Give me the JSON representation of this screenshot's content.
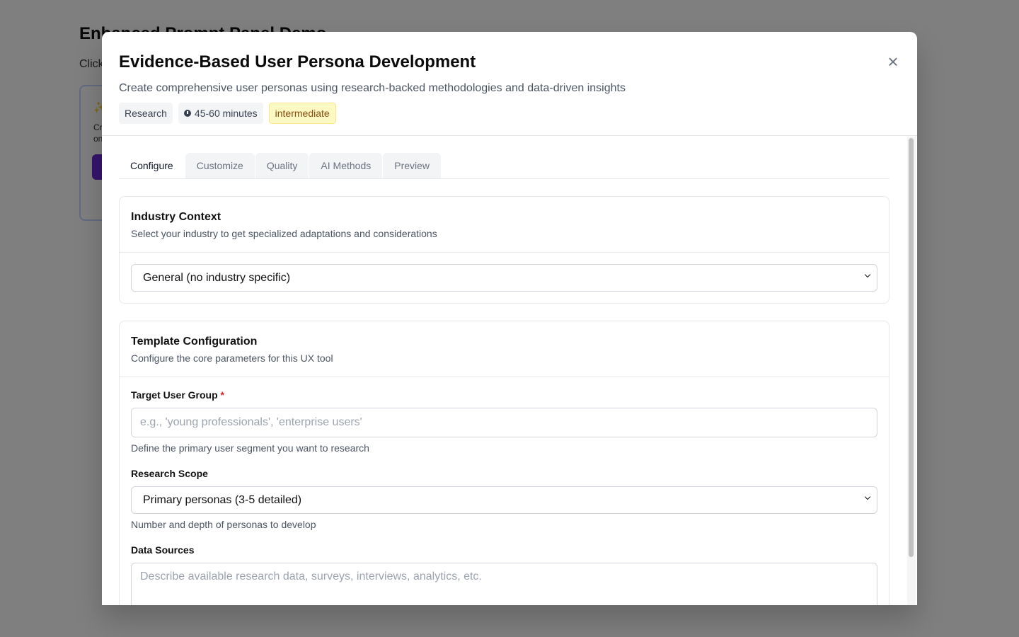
{
  "background": {
    "title": "Enhanced Prompt Panel Demo",
    "subtitle": "Click",
    "card_icon": "sparkles-icon",
    "card_text": "Cr\non"
  },
  "modal": {
    "title": "Evidence-Based User Persona Development",
    "description": "Create comprehensive user personas using research-backed methodologies and data-driven insights",
    "badges": {
      "category": "Research",
      "duration": "45-60 minutes",
      "level": "intermediate"
    },
    "close_label": "×"
  },
  "tabs": [
    "Configure",
    "Customize",
    "Quality",
    "AI Methods",
    "Preview"
  ],
  "active_tab": "Configure",
  "industry": {
    "title": "Industry Context",
    "subtitle": "Select your industry to get specialized adaptations and considerations",
    "selected": "General (no industry specific)"
  },
  "template": {
    "title": "Template Configuration",
    "subtitle": "Configure the core parameters for this UX tool",
    "target_user_group": {
      "label": "Target User Group",
      "required_mark": "*",
      "placeholder": "e.g., 'young professionals', 'enterprise users'",
      "help": "Define the primary user segment you want to research"
    },
    "research_scope": {
      "label": "Research Scope",
      "selected": "Primary personas (3-5 detailed)",
      "help": "Number and depth of personas to develop"
    },
    "data_sources": {
      "label": "Data Sources",
      "placeholder": "Describe available research data, surveys, interviews, analytics, etc."
    }
  },
  "colors": {
    "overlay": "rgba(0,0,0,0.5)",
    "level_badge_bg": "#fef9c3",
    "level_badge_text": "#854d0e",
    "required": "#dc2626"
  }
}
